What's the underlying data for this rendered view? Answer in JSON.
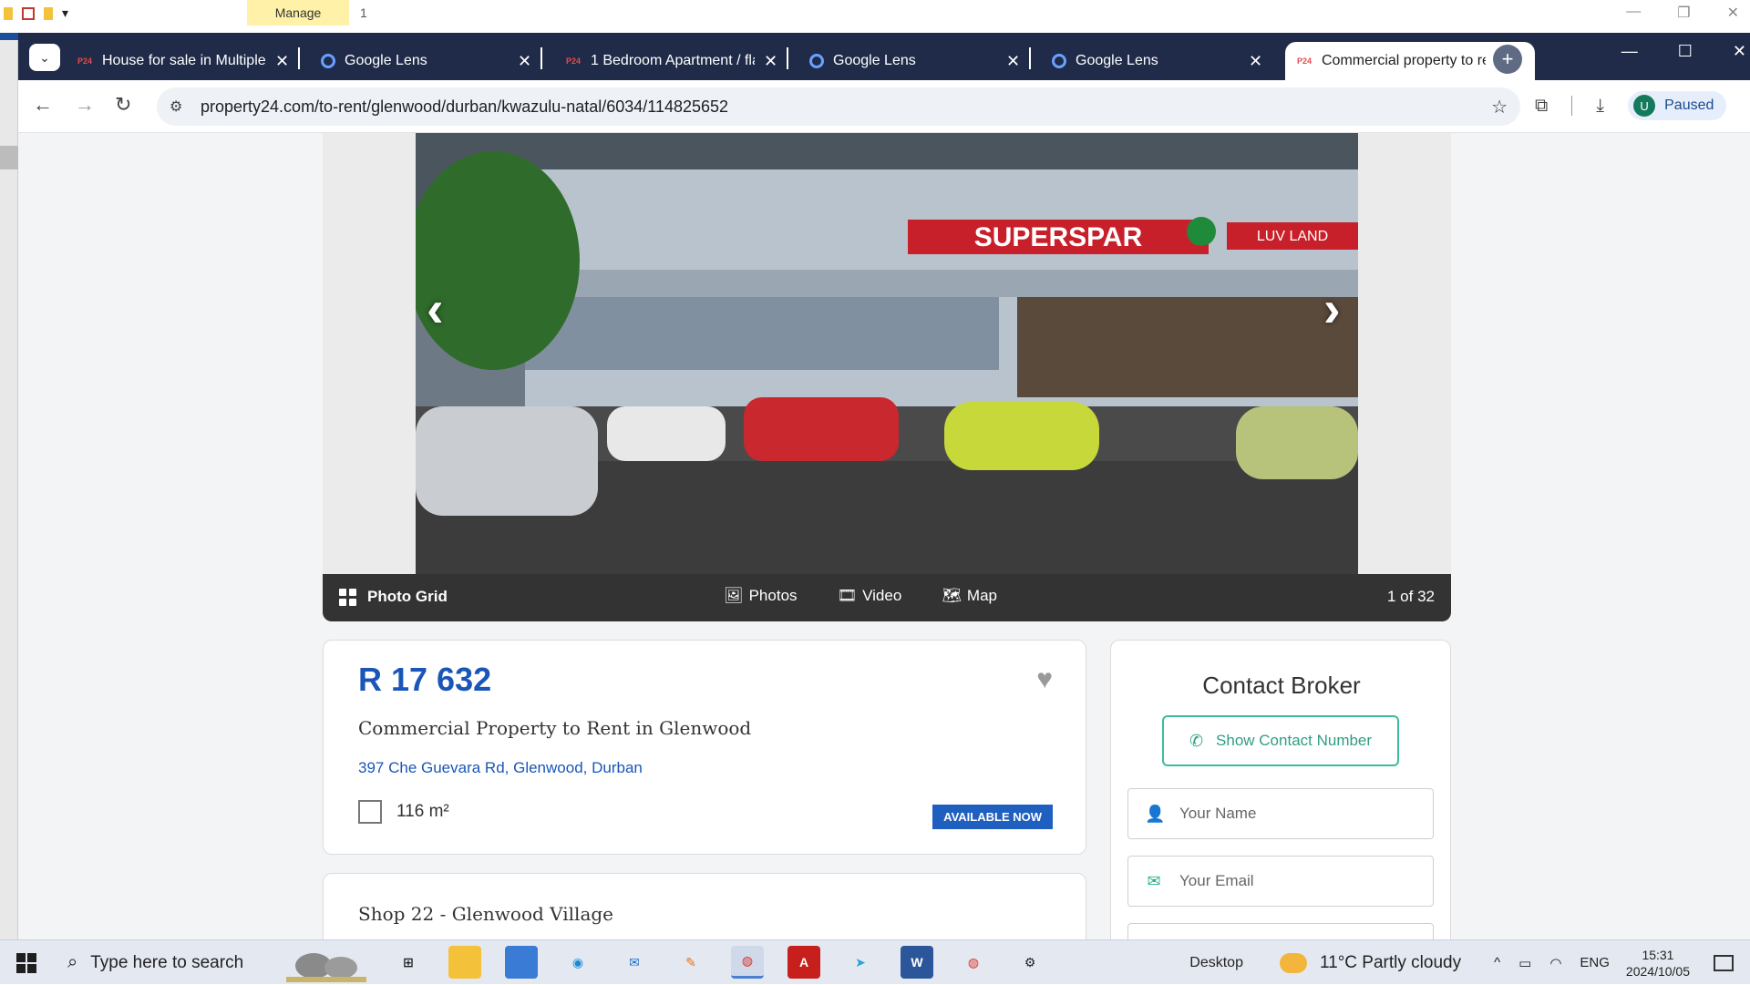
{
  "ribbon": {
    "manage_label": "Manage",
    "page_number": "1"
  },
  "tabs": [
    {
      "title": "House for sale in Multiple S",
      "favicon": "p24"
    },
    {
      "title": "Google Lens",
      "favicon": "lens"
    },
    {
      "title": "1 Bedroom Apartment / fla",
      "favicon": "p24"
    },
    {
      "title": "Google Lens",
      "favicon": "lens"
    },
    {
      "title": "Google Lens",
      "favicon": "lens"
    },
    {
      "title": "Commercial property to re",
      "favicon": "p24",
      "active": true
    }
  ],
  "favicon_p24_text": "P24",
  "omnibox": {
    "url": "property24.com/to-rent/glenwood/durban/kwazulu-natal/6034/114825652"
  },
  "profile": {
    "initial": "U",
    "status": "Paused"
  },
  "gallery": {
    "photo_grid_label": "Photo Grid",
    "photos_label": "Photos",
    "video_label": "Video",
    "map_label": "Map",
    "counter": "1 of 32",
    "sign_text": "SUPERSPAR",
    "sign2_text": "LUV  LAND"
  },
  "listing": {
    "price": "R 17 632",
    "title": "Commercial Property to Rent in Glenwood",
    "address": "397 Che Guevara Rd, Glenwood, Durban",
    "size": "116 m²",
    "availability": "AVAILABLE NOW",
    "shop_title": "Shop 22 - Glenwood Village"
  },
  "contact": {
    "title": "Contact Broker",
    "show_number_label": "Show Contact Number",
    "name_placeholder": "Your Name",
    "email_placeholder": "Your Email"
  },
  "taskbar": {
    "search_placeholder": "Type here to search",
    "desktop_label": "Desktop",
    "weather": "11°C  Partly cloudy",
    "language": "ENG",
    "time": "15:31",
    "date": "2024/10/05"
  },
  "colors": {
    "tabbar": "#1f2b48",
    "price_blue": "#1a56b8",
    "accent_green": "#3dbc9c",
    "badge_blue": "#1f5fbf"
  }
}
